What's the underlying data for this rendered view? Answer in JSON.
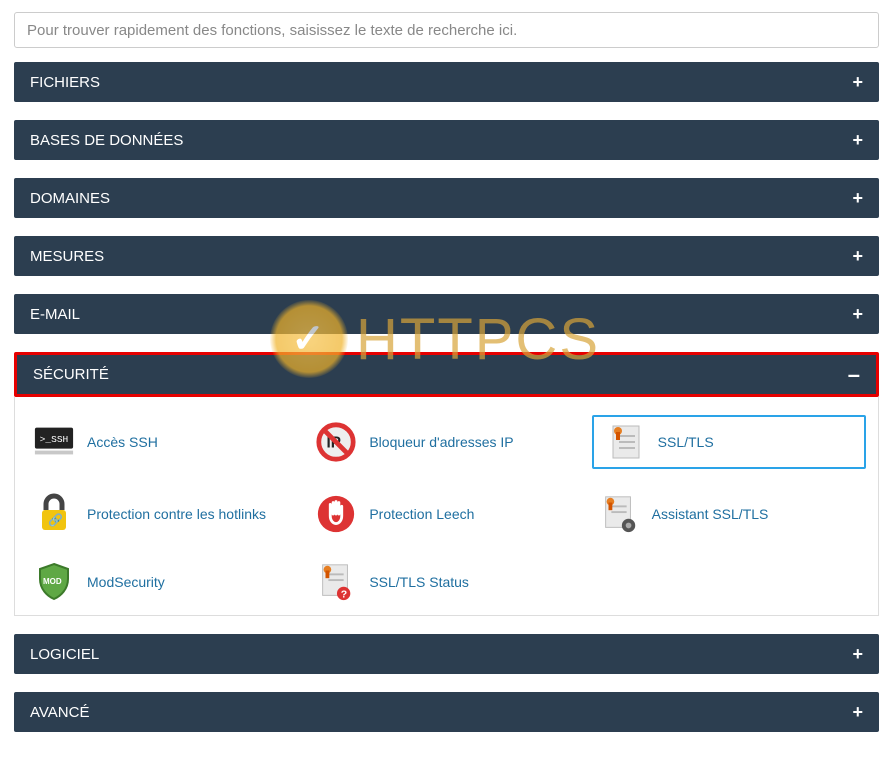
{
  "search": {
    "placeholder": "Pour trouver rapidement des fonctions, saisissez le texte de recherche ici."
  },
  "panels": {
    "fichiers": "FICHIERS",
    "bdd": "BASES DE DONNÉES",
    "domaines": "DOMAINES",
    "mesures": "MESURES",
    "email": "E-MAIL",
    "securite": "SÉCURITÉ",
    "logiciel": "LOGICIEL",
    "avance": "AVANCÉ"
  },
  "securite_items": {
    "ssh": "Accès SSH",
    "ipblock": "Bloqueur d'adresses IP",
    "ssltls": "SSL/TLS",
    "hotlink": "Protection contre les hotlinks",
    "leech": "Protection Leech",
    "sslassist": "Assistant SSL/TLS",
    "modsec": "ModSecurity",
    "sslstatus": "SSL/TLS Status"
  },
  "watermark": "HTTPCS"
}
